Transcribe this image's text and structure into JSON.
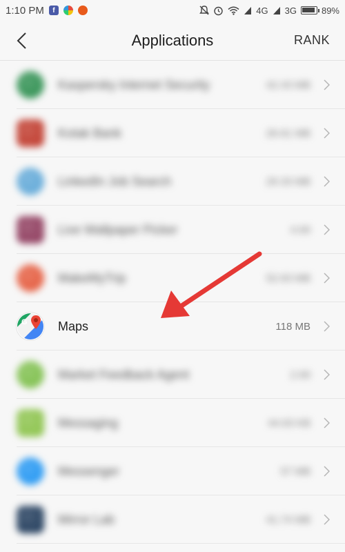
{
  "status_bar": {
    "time": "1:10 PM",
    "network_4g": "4G",
    "network_3g": "3G",
    "battery": "89%"
  },
  "header": {
    "title": "Applications",
    "rank_label": "RANK"
  },
  "apps": [
    {
      "name": "Kaspersky Internet Security",
      "size": "42.43 MB",
      "blurred": true,
      "icon": "globe-icon",
      "color": "#2d8f4f"
    },
    {
      "name": "Kotak Bank",
      "size": "26.61 MB",
      "blurred": true,
      "icon": "bank-icon",
      "color": "#c0392b"
    },
    {
      "name": "LinkedIn Job Search",
      "size": "29.33 MB",
      "blurred": true,
      "icon": "briefcase-icon",
      "color": "#5fa8d8"
    },
    {
      "name": "Live Wallpaper Picker",
      "size": "4.00",
      "blurred": true,
      "icon": "wallpaper-icon",
      "color": "#8e3a5c"
    },
    {
      "name": "MakeMyTrip",
      "size": "52.63 MB",
      "blurred": true,
      "icon": "travel-icon",
      "color": "#e55a3c"
    },
    {
      "name": "Maps",
      "size": "118 MB",
      "blurred": false,
      "icon": "google-maps-icon",
      "color": "#4285f4"
    },
    {
      "name": "Market Feedback Agent",
      "size": "2.00",
      "blurred": true,
      "icon": "android-icon",
      "color": "#7dbf4a"
    },
    {
      "name": "Messaging",
      "size": "44.63 KB",
      "blurred": true,
      "icon": "message-icon",
      "color": "#8bc34a"
    },
    {
      "name": "Messenger",
      "size": "57 MB",
      "blurred": true,
      "icon": "messenger-icon",
      "color": "#2196f3"
    },
    {
      "name": "Mirror Lab",
      "size": "41.74 MB",
      "blurred": true,
      "icon": "mirror-icon",
      "color": "#1f3a5a"
    }
  ],
  "annotation": {
    "arrow_color": "#e53935",
    "points_to": "Maps"
  }
}
